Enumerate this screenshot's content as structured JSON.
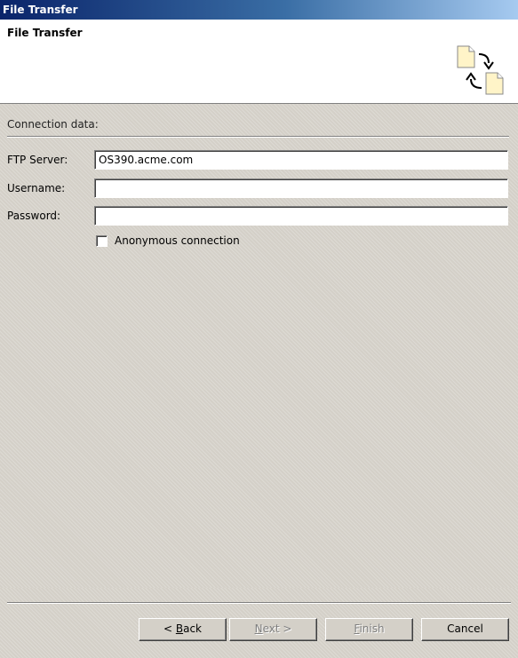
{
  "window": {
    "title": "File Transfer"
  },
  "banner": {
    "title": "File Transfer",
    "icon": "file-transfer-icon"
  },
  "form": {
    "section_label": "Connection data:",
    "ftp_server": {
      "label": "FTP Server:",
      "value": "OS390.acme.com"
    },
    "username": {
      "label": "Username:",
      "value": ""
    },
    "password": {
      "label": "Password:",
      "value": ""
    },
    "anonymous": {
      "label": "Anonymous connection",
      "checked": false
    }
  },
  "buttons": {
    "back": {
      "prefix": "< ",
      "mnemonic": "B",
      "rest": "ack",
      "enabled": true
    },
    "next": {
      "mnemonic": "N",
      "rest": "ext >",
      "enabled": false
    },
    "finish": {
      "mnemonic": "F",
      "rest": "inish",
      "enabled": false
    },
    "cancel": {
      "label": "Cancel",
      "enabled": true
    }
  }
}
